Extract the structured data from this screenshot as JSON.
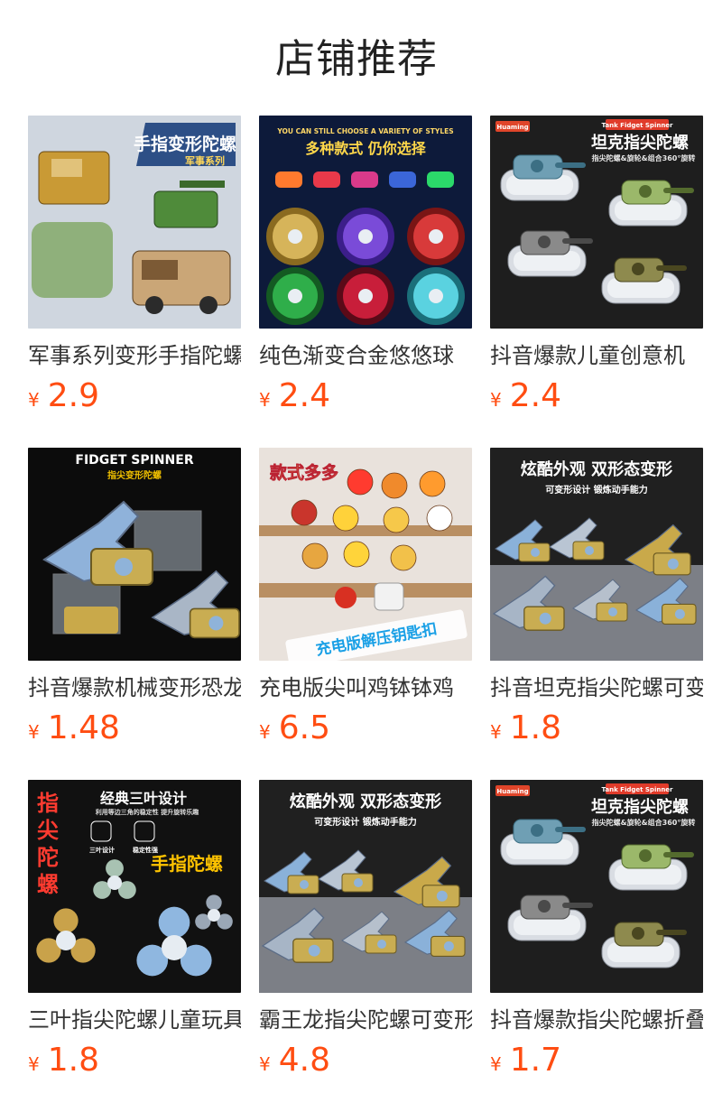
{
  "page": {
    "title": "店铺推荐"
  },
  "products": [
    {
      "name": "军事系列变形手指陀螺",
      "currency": "¥",
      "price": "2.9",
      "image": {
        "theme": "military-transform-spinner",
        "bg": "#cfd6df",
        "headline": "手指变形陀螺",
        "sub": "军事系列"
      }
    },
    {
      "name": "纯色渐变合金悠悠球",
      "currency": "¥",
      "price": "2.4",
      "image": {
        "theme": "alloy-yoyo",
        "bg": "#0d1a3a",
        "top": "YOU CAN STILL CHOOSE A VARIETY OF STYLES",
        "headline": "多种款式 仍你选择"
      }
    },
    {
      "name": "抖音爆款儿童创意机",
      "currency": "¥",
      "price": "2.4",
      "image": {
        "theme": "tank-spinner",
        "bg": "#1e1e1e",
        "badge": "Huaming",
        "tag": "Tank Fidget Spinner",
        "headline": "坦克指尖陀螺",
        "sub": "指尖陀螺&旋轮&组合360°旋转"
      }
    },
    {
      "name": "抖音爆款机械变形恐龙",
      "currency": "¥",
      "price": "1.48",
      "image": {
        "theme": "mech-dino",
        "bg": "#0c0c0c",
        "top": "FIDGET SPINNER",
        "sub": "指尖变形陀螺"
      }
    },
    {
      "name": "充电版尖叫鸡钵钵鸡",
      "currency": "¥",
      "price": "6.5",
      "image": {
        "theme": "keychain-squeeze",
        "bg": "#e9e2dc",
        "headline": "款式多多",
        "bottom": "充电版解压钥匙扣"
      }
    },
    {
      "name": "抖音坦克指尖陀螺可变",
      "currency": "¥",
      "price": "1.8",
      "image": {
        "theme": "dino-spinner",
        "bg": "#202020",
        "headline": "炫酷外观 双形态变形",
        "sub": "可变形设计 锻炼动手能力"
      }
    },
    {
      "name": "三叶指尖陀螺儿童玩具",
      "currency": "¥",
      "price": "1.8",
      "image": {
        "theme": "tri-spinner",
        "bg": "#111111",
        "side": "指尖陀螺",
        "headline": "经典三叶设计",
        "sub": "利用等边三角的稳定性 提升旋转乐趣",
        "tag": "手指陀螺",
        "l1": "三叶设计",
        "l2": "稳定性强"
      }
    },
    {
      "name": "霸王龙指尖陀螺可变形",
      "currency": "¥",
      "price": "4.8",
      "image": {
        "theme": "dino-spinner",
        "bg": "#202020",
        "headline": "炫酷外观 双形态变形",
        "sub": "可变形设计 锻炼动手能力"
      }
    },
    {
      "name": "抖音爆款指尖陀螺折叠",
      "currency": "¥",
      "price": "1.7",
      "image": {
        "theme": "tank-spinner",
        "bg": "#1e1e1e",
        "badge": "Huaming",
        "tag": "Tank Fidget Spinner",
        "headline": "坦克指尖陀螺",
        "sub": "指尖陀螺&旋轮&组合360°旋转"
      }
    }
  ]
}
